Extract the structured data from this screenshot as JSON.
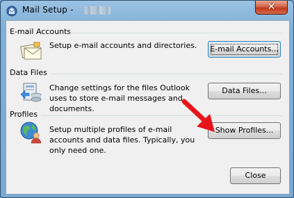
{
  "window": {
    "title": "Mail Setup - ",
    "close_glyph": "✕"
  },
  "sections": [
    {
      "label": "E-mail Accounts",
      "icon": "envelopes-icon",
      "description": "Setup e-mail accounts and directories.",
      "button": "E-mail Accounts..."
    },
    {
      "label": "Data Files",
      "icon": "data-files-icon",
      "description": "Change settings for the files Outlook uses to store e-mail messages and documents.",
      "button": "Data Files..."
    },
    {
      "label": "Profiles",
      "icon": "profiles-icon",
      "description": "Setup multiple profiles of e-mail accounts and data files. Typically, you only need one.",
      "button": "Show Profiles..."
    }
  ],
  "footer": {
    "close_label": "Close"
  },
  "colors": {
    "annotation_arrow": "#e8141b",
    "title_gradient_top": "#9bc2e3",
    "client_bg": "#f0f0f0"
  }
}
